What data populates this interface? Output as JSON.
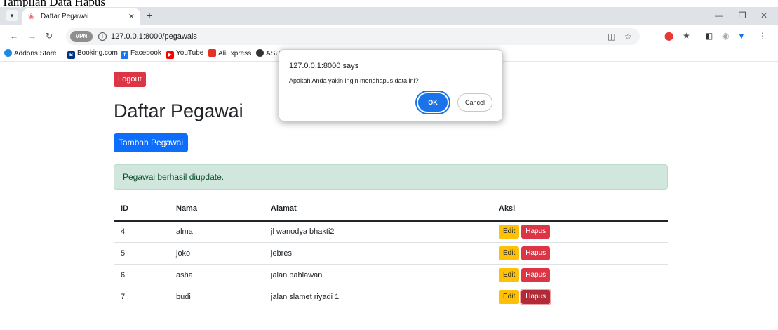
{
  "caption": "Tampilan Data Hapus",
  "browser": {
    "tab_title": "Daftar Pegawai",
    "url": "127.0.0.1:8000/pegawais",
    "vpn_label": "VPN",
    "bookmarks": [
      "Addons Store",
      "Booking.com",
      "Facebook",
      "YouTube",
      "AliExpress",
      "ASUS"
    ]
  },
  "page": {
    "logout_label": "Logout",
    "title": "Daftar Pegawai",
    "add_label": "Tambah Pegawai",
    "alert": "Pegawai berhasil diupdate.",
    "table": {
      "headers": [
        "ID",
        "Nama",
        "Alamat",
        "Aksi"
      ],
      "rows": [
        {
          "id": "4",
          "nama": "alma",
          "alamat": "jl wanodya bhakti2"
        },
        {
          "id": "5",
          "nama": "joko",
          "alamat": "jebres"
        },
        {
          "id": "6",
          "nama": "asha",
          "alamat": "jalan pahlawan"
        },
        {
          "id": "7",
          "nama": "budi",
          "alamat": "jalan slamet riyadi 1"
        }
      ],
      "edit_label": "Edit",
      "delete_label": "Hapus"
    }
  },
  "dialog": {
    "title": "127.0.0.1:8000 says",
    "message": "Apakah Anda yakin ingin menghapus data ini?",
    "ok_label": "OK",
    "cancel_label": "Cancel"
  },
  "colors": {
    "danger": "#dc3545",
    "primary": "#0d6efd",
    "warning": "#ffc107",
    "success_bg": "#d1e7dd",
    "dialog_ok": "#1a73e8"
  }
}
